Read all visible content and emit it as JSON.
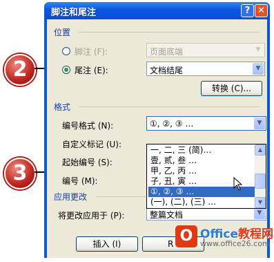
{
  "dialog": {
    "title": "脚注和尾注",
    "help_glyph": "?",
    "close_glyph": "✕"
  },
  "location": {
    "section_label": "位置",
    "footnote_label": "脚注 (F):",
    "footnote_value": "页面底端",
    "endnote_label": "尾注 (E):",
    "endnote_value": "文档结尾",
    "convert_button": "转换 (C)..."
  },
  "format": {
    "section_label": "格式",
    "number_format_label": "编号格式 (N):",
    "number_format_value": "①, ②, ③ …",
    "custom_mark_label": "自定义标记 (U):",
    "start_at_label": "起始编号 (S):",
    "numbering_label": "编号 (M):",
    "dropdown_options": [
      "一, 二, 三 (简)…",
      "壹, 贰, 叁 …",
      "甲, 乙, 丙 …",
      "子, 丑, 寅 …",
      "①, ②, ③ …",
      "(一), (二), (三) …"
    ],
    "selected_index": 4
  },
  "apply": {
    "section_label": "应用更改",
    "apply_to_label": "将更改应用于 (P):",
    "apply_to_value": "整篇文档"
  },
  "buttons": {
    "insert": "插入 (I)",
    "cancel_partial": "R"
  },
  "callouts": {
    "step_a": "2",
    "step_b": "3"
  },
  "watermark": {
    "logo_letter": "O",
    "brand": "Office",
    "brand_cn": "教程网",
    "url": "www.office26.com"
  },
  "colors": {
    "title_bar": "#0a57d8",
    "dialog_bg": "#ece9d8",
    "section_text": "#0d3fb0",
    "selection": "#316ac5",
    "callout_red": "#c0261f"
  }
}
